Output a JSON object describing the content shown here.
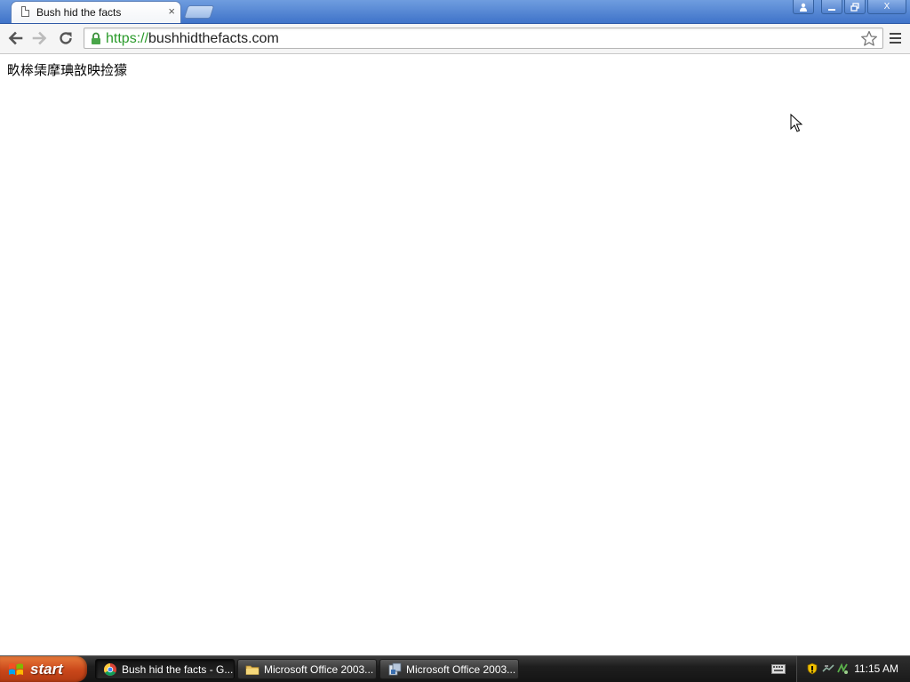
{
  "browser": {
    "tab": {
      "title": "Bush hid the facts",
      "close_glyph": "×"
    },
    "window_controls": {
      "profile_icon": "profile-icon",
      "minimize_icon": "minimize-icon",
      "maximize_icon": "restore-icon",
      "close_label": "X"
    },
    "toolbar": {
      "back_icon": "back-arrow-icon",
      "forward_icon": "forward-arrow-icon",
      "reload_icon": "reload-icon",
      "url_scheme": "https://",
      "url_host": "bushhidthefacts.com",
      "lock_icon": "lock-icon",
      "star_icon": "star-icon",
      "menu_icon": "menu-icon"
    }
  },
  "page": {
    "text": "畂桳栠摩琠敨映捡獴"
  },
  "taskbar": {
    "start_label": "start",
    "tasks": [
      {
        "label": "Bush hid the facts - G...",
        "icon": "chrome-icon",
        "active": true
      },
      {
        "label": "Microsoft Office 2003...",
        "icon": "folder-icon",
        "active": false
      },
      {
        "label": "Microsoft Office 2003...",
        "icon": "installer-icon",
        "active": false
      }
    ],
    "clock": "11:15 AM"
  },
  "colors": {
    "url_scheme": "#2a9a2a",
    "titlebar": "#4a7fd0",
    "start_button": "#c9471a"
  }
}
